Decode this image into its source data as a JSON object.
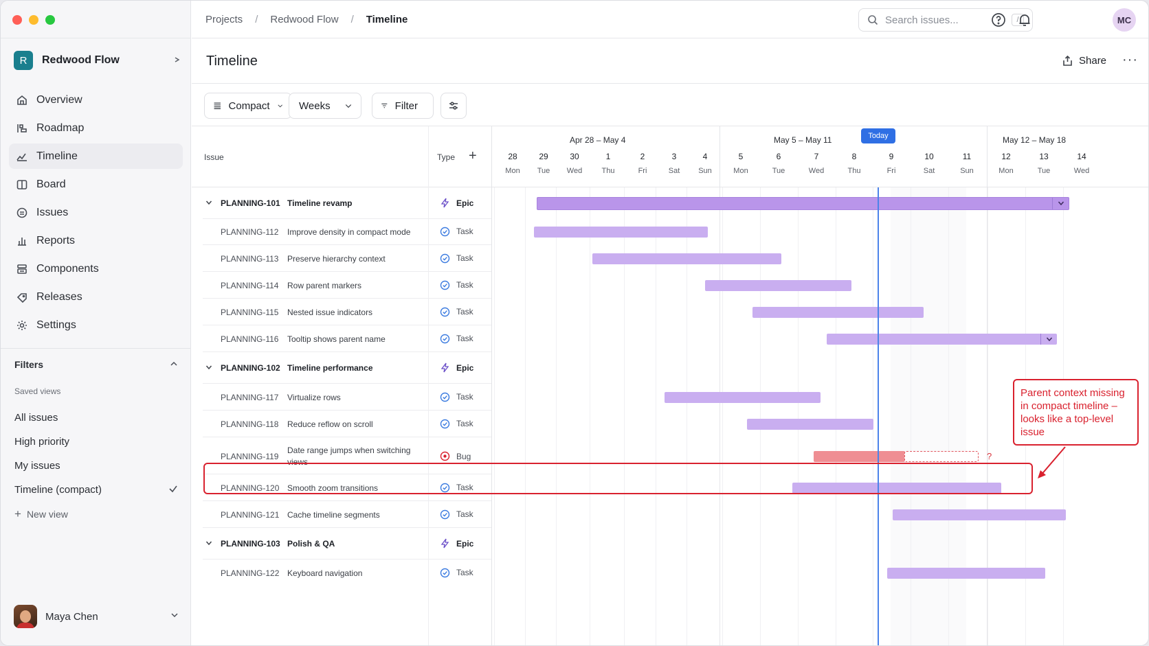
{
  "sidebar": {
    "project": {
      "initial": "R",
      "name": "Redwood Flow",
      "switch_glyph": "⇄"
    },
    "nav": [
      {
        "label": "Overview",
        "icon": "home-icon"
      },
      {
        "label": "Roadmap",
        "icon": "roadmap-icon"
      },
      {
        "label": "Timeline",
        "icon": "timeline-icon",
        "active": true
      },
      {
        "label": "Board",
        "icon": "board-icon"
      },
      {
        "label": "Issues",
        "icon": "issues-icon"
      },
      {
        "label": "Reports",
        "icon": "reports-icon"
      },
      {
        "label": "Components",
        "icon": "components-icon"
      },
      {
        "label": "Releases",
        "icon": "releases-icon"
      },
      {
        "label": "Settings",
        "icon": "gear-icon"
      }
    ],
    "filters": {
      "title": "Filters",
      "saved_label": "Saved views",
      "views": [
        "All issues",
        "High priority",
        "My issues",
        "Timeline (compact)"
      ],
      "new_view": "New view"
    },
    "user": {
      "name": "Maya Chen"
    }
  },
  "topbar": {
    "breadcrumbs": [
      "Projects",
      "Redwood Flow",
      "Timeline"
    ],
    "search_placeholder": "Search issues...",
    "search_shortcut": "/",
    "avatar_initials": "MC"
  },
  "page": {
    "title": "Timeline",
    "share_label": "Share"
  },
  "toolbar": {
    "density": "Compact",
    "scale": "Weeks",
    "filter": "Filter"
  },
  "grid": {
    "col_issue": "Issue",
    "col_type": "Type",
    "weeks": [
      "Apr 28 – May 4",
      "May 5 – May 11",
      "May 12 – May 18"
    ],
    "days": [
      {
        "n": "28",
        "w": "Mon"
      },
      {
        "n": "29",
        "w": "Tue"
      },
      {
        "n": "30",
        "w": "Wed"
      },
      {
        "n": "1",
        "w": "Thu"
      },
      {
        "n": "2",
        "w": "Fri"
      },
      {
        "n": "3",
        "w": "Sat"
      },
      {
        "n": "4",
        "w": "Sun"
      },
      {
        "n": "5",
        "w": "Mon"
      },
      {
        "n": "6",
        "w": "Tue"
      },
      {
        "n": "7",
        "w": "Wed"
      },
      {
        "n": "8",
        "w": "Thu"
      },
      {
        "n": "9",
        "w": "Fri"
      },
      {
        "n": "10",
        "w": "Sat"
      },
      {
        "n": "11",
        "w": "Sun"
      },
      {
        "n": "12",
        "w": "Mon"
      },
      {
        "n": "13",
        "w": "Tue"
      },
      {
        "n": "14",
        "w": "Wed"
      }
    ],
    "today_label": "Today",
    "rows": [
      {
        "key": "PLANNING-101",
        "title": "Timeline revamp",
        "type": "Epic"
      },
      {
        "key": "PLANNING-112",
        "title": "Improve density in compact mode",
        "type": "Task"
      },
      {
        "key": "PLANNING-113",
        "title": "Preserve hierarchy context",
        "type": "Task"
      },
      {
        "key": "PLANNING-114",
        "title": "Row parent markers",
        "type": "Task"
      },
      {
        "key": "PLANNING-115",
        "title": "Nested issue indicators",
        "type": "Task"
      },
      {
        "key": "PLANNING-116",
        "title": "Tooltip shows parent name",
        "type": "Task"
      },
      {
        "key": "PLANNING-102",
        "title": "Timeline performance",
        "type": "Epic"
      },
      {
        "key": "PLANNING-117",
        "title": "Virtualize rows",
        "type": "Task"
      },
      {
        "key": "PLANNING-118",
        "title": "Reduce reflow on scroll",
        "type": "Task"
      },
      {
        "key": "PLANNING-119",
        "title": "Date range jumps when switching views",
        "type": "Bug",
        "unknown_end_marker": "?"
      },
      {
        "key": "PLANNING-120",
        "title": "Smooth zoom transitions",
        "type": "Task"
      },
      {
        "key": "PLANNING-121",
        "title": "Cache timeline segments",
        "type": "Task"
      },
      {
        "key": "PLANNING-103",
        "title": "Polish & QA",
        "type": "Epic"
      },
      {
        "key": "PLANNING-122",
        "title": "Keyboard navigation",
        "type": "Task"
      }
    ]
  },
  "annotation": {
    "text": "Parent context missing in compact timeline – looks like a top-level issue"
  },
  "colors": {
    "accent": "#2f6fe4",
    "task_bar": "#c9aef0",
    "epic_bar": "#b995ea",
    "bug_bar": "#ef8e93",
    "annotation_red": "#d9212e"
  }
}
